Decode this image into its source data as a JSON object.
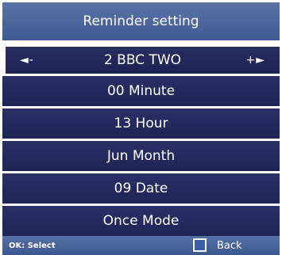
{
  "title": "Reminder setting",
  "rows": [
    {
      "label": "2 BBC TWO",
      "left_arrow": "◄-",
      "right_arrow": "+►"
    },
    {
      "label": "00 Minute"
    },
    {
      "label": "13 Hour"
    },
    {
      "label": "Jun Month"
    },
    {
      "label": "09 Date"
    },
    {
      "label": "Once Mode"
    }
  ],
  "footer": {
    "ok_hint": "OK: Select",
    "back_label": "Back"
  },
  "colors": {
    "title_bar": "#4a659c",
    "row_bg": "#252a5e",
    "footer_bg": "#4a659c",
    "back_box": "#3b5ea8"
  }
}
